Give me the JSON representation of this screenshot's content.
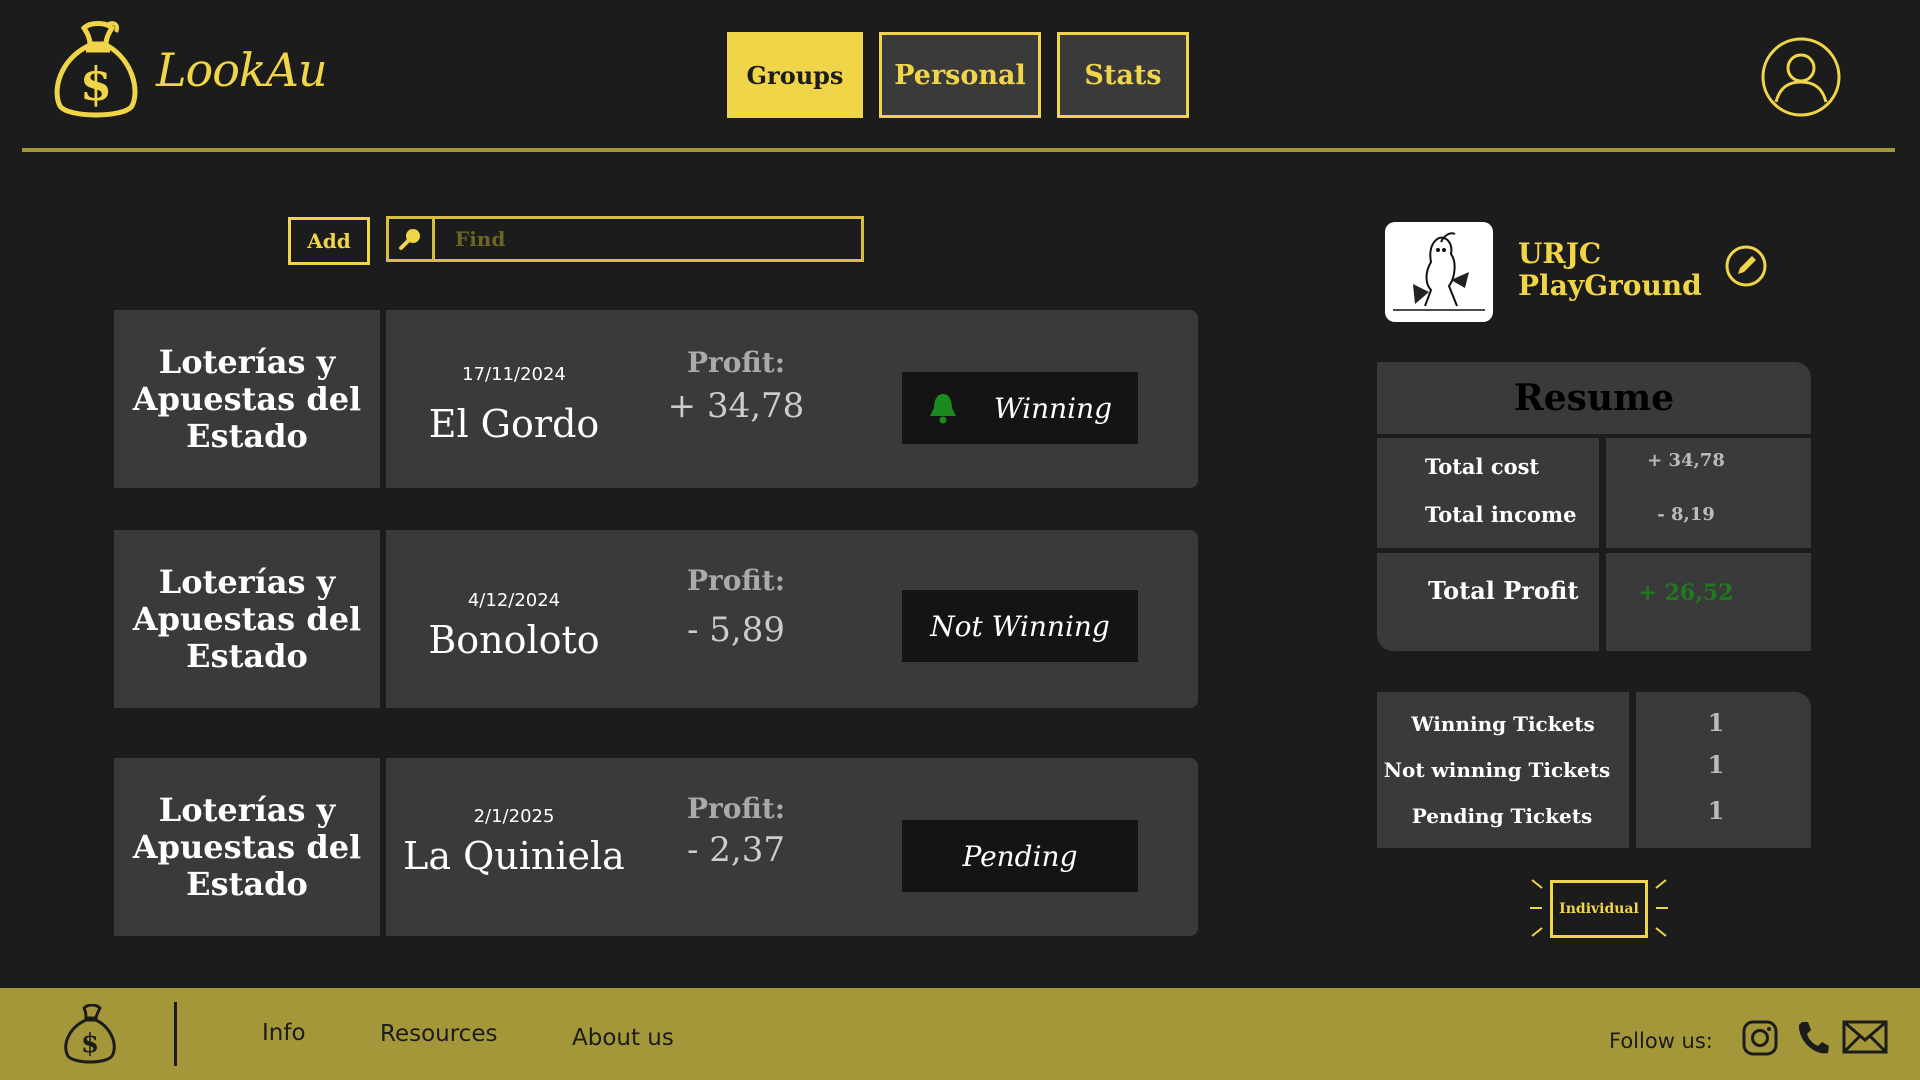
{
  "brand": {
    "name": "LookAu",
    "accent": "#f0d548",
    "footer_color": "#a4973a",
    "background": "#1c1c1c",
    "card_color": "#3a3a3a"
  },
  "nav": {
    "tabs": [
      {
        "label": "Groups",
        "active": true
      },
      {
        "label": "Personal",
        "active": false
      },
      {
        "label": "Stats",
        "active": false
      }
    ],
    "profile_icon": "user-circle-icon"
  },
  "toolbar": {
    "add_label": "Add",
    "search_placeholder": "Find",
    "search_icon": "magnifier-icon"
  },
  "tickets": [
    {
      "organization": "Loterías y Apuestas del Estado",
      "date": "17/11/2024",
      "name": "El Gordo",
      "profit_label": "Profit:",
      "profit": "+ 34,78",
      "status": "Winning",
      "status_icon": "bell-icon"
    },
    {
      "organization": "Loterías y Apuestas del Estado",
      "date": "4/12/2024",
      "name": "Bonoloto",
      "profit_label": "Profit:",
      "profit": "- 5,89",
      "status": "Not Winning"
    },
    {
      "organization": "Loterías y Apuestas del Estado",
      "date": "2/1/2025",
      "name": "La Quiniela",
      "profit_label": "Profit:",
      "profit": "- 2,37",
      "status": "Pending"
    }
  ],
  "group": {
    "name": "URJC PlayGround",
    "edit_icon": "pencil-icon"
  },
  "resume": {
    "title": "Resume",
    "total_cost_label": "Total cost",
    "total_cost": "+ 34,78",
    "total_income_label": "Total income",
    "total_income": "- 8,19",
    "total_profit_label": "Total Profit",
    "total_profit": "+ 26,52",
    "profit_color": "#1f7a1f"
  },
  "ticket_counts": {
    "winning_label": "Winning Tickets",
    "winning": "1",
    "not_winning_label": "Not winning Tickets",
    "not_winning": "1",
    "pending_label": "Pending Tickets",
    "pending": "1"
  },
  "individual_label": "Individual",
  "footer": {
    "links": [
      "Info",
      "Resources",
      "About us"
    ],
    "follow_label": "Follow us:",
    "social_icons": [
      "instagram-icon",
      "phone-icon",
      "mail-icon"
    ]
  }
}
